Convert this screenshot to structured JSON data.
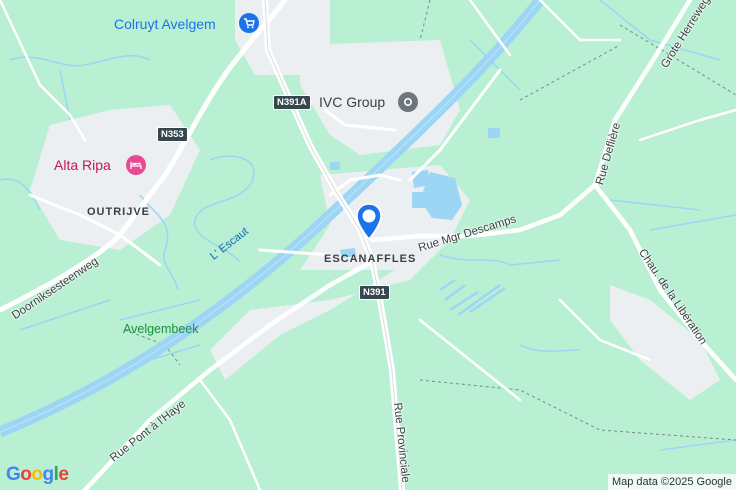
{
  "map": {
    "colors": {
      "land": "#b9f0d3",
      "water": "#9dd6f5",
      "urban": "#eceff1",
      "road": "#ffffff",
      "marker": "#1a73e8",
      "poi_shop": "#1a73e8",
      "poi_hotel": "#e94992"
    },
    "pois": [
      {
        "name": "Colruyt Avelgem",
        "icon": "shopping-cart-icon"
      },
      {
        "name": "IVC Group",
        "icon": "place-pin-icon"
      },
      {
        "name": "Alta Ripa",
        "icon": "hotel-icon"
      }
    ],
    "places": {
      "escanaffles": "ESCANAFFLES",
      "outrijve": "OUTRIJVE"
    },
    "green_labels": {
      "avelgembeek": "Avelgembeek"
    },
    "water_labels": {
      "escaut": "L' Escaut"
    },
    "roads": {
      "rue_mgr_descamps": "Rue Mgr Descamps",
      "doorniksesteenweg": "Doorniksesteenweg",
      "rue_pont_a_lhaye": "Rue Pont à l'Haye",
      "rue_provinciale": "Rue Provinciale",
      "rue_defliere": "Rue Deflière",
      "grote_herreweg": "Grote Herreweg",
      "chau_liberation": "Chau. de la Libération"
    },
    "shields": {
      "n391a": "N391A",
      "n353": "N353",
      "n391": "N391"
    },
    "footer": {
      "logo": "Google",
      "attribution": "Map data ©2025 Google"
    }
  }
}
